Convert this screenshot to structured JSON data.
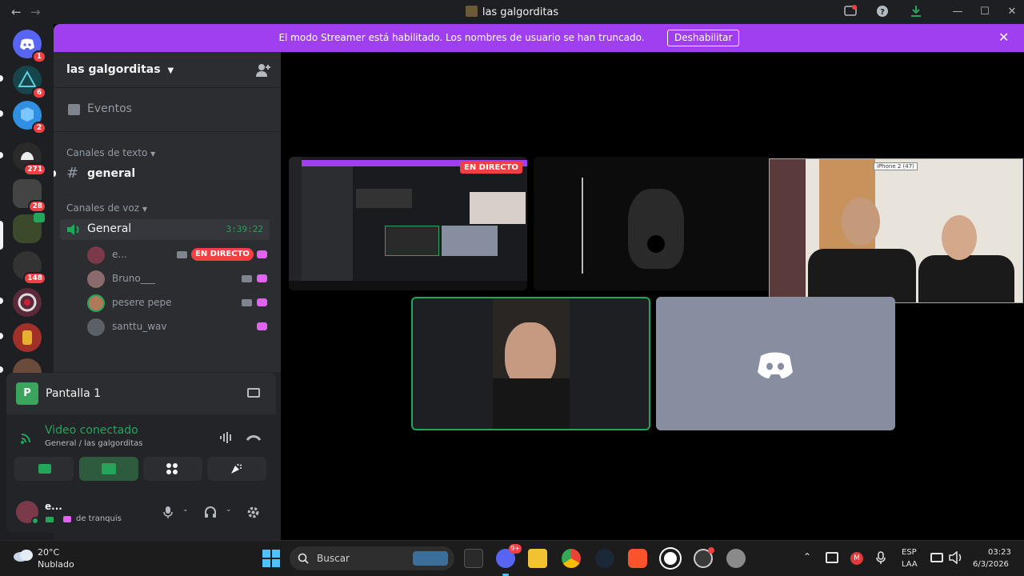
{
  "window": {
    "title": "las galgorditas",
    "back_glyph": "←",
    "forward_glyph": "→",
    "minimize": "—",
    "maximize": "☐",
    "close": "✕"
  },
  "server_rail": {
    "items": [
      {
        "name": "direct-messages",
        "badge": "1",
        "color": "#5865f2"
      },
      {
        "name": "server-a",
        "badge": "6",
        "color": "#1f6f7a"
      },
      {
        "name": "server-b",
        "badge": "2",
        "color": "#2f8fe0"
      },
      {
        "name": "server-c",
        "badge": "271",
        "color": "#2a2a2a"
      },
      {
        "name": "server-d",
        "badge": "28",
        "color": "#444"
      },
      {
        "name": "server-e",
        "badge": "",
        "color": "#3a4a2a"
      },
      {
        "name": "server-f",
        "badge": "148",
        "color": "#333"
      },
      {
        "name": "server-g",
        "badge": "",
        "color": "#5a2a3a"
      },
      {
        "name": "server-h",
        "badge": "",
        "color": "#a03028"
      },
      {
        "name": "server-i",
        "badge": "",
        "color": "#6a4a3a"
      }
    ]
  },
  "banner": {
    "text": "El modo Streamer está habilitado. Los nombres de usuario se han truncado.",
    "button": "Deshabilitar",
    "close": "✕"
  },
  "sidebar": {
    "server_name": "las galgorditas",
    "events": "Eventos",
    "text_category": "Canales de texto",
    "text_channel": "general",
    "voice_category": "Canales de voz",
    "voice_channel": "General",
    "voice_timer": "3:39:22",
    "voice_users": [
      {
        "name": "e...",
        "live": "EN DIRECTO",
        "avatar": "#7a3a4a"
      },
      {
        "name": "Bruno___",
        "avatar": "#8a6a6a"
      },
      {
        "name": "pesere pepe",
        "avatar": "#b07a5a"
      },
      {
        "name": "santtu_wav",
        "avatar": "#5b5f66"
      }
    ]
  },
  "rtc": {
    "screen_label": "Pantalla 1",
    "status": "Video conectado",
    "location": "General / las galgorditas"
  },
  "user": {
    "name": "e...",
    "status": "de tranquis"
  },
  "stage": {
    "live_badge": "EN DIRECTO",
    "phone_label": "iPhone 2 (47)",
    "colors": {
      "speaking": "#23a55a",
      "blurple": "#5865f2",
      "grey_tile": "#868ea0"
    }
  },
  "taskbar": {
    "weather_temp": "20°C",
    "weather_desc": "Nublado",
    "search": "Buscar",
    "lang_top": "ESP",
    "lang_bottom": "LAA",
    "time": "03:23",
    "date": "6/3/2026",
    "discord_badge": "9+"
  }
}
